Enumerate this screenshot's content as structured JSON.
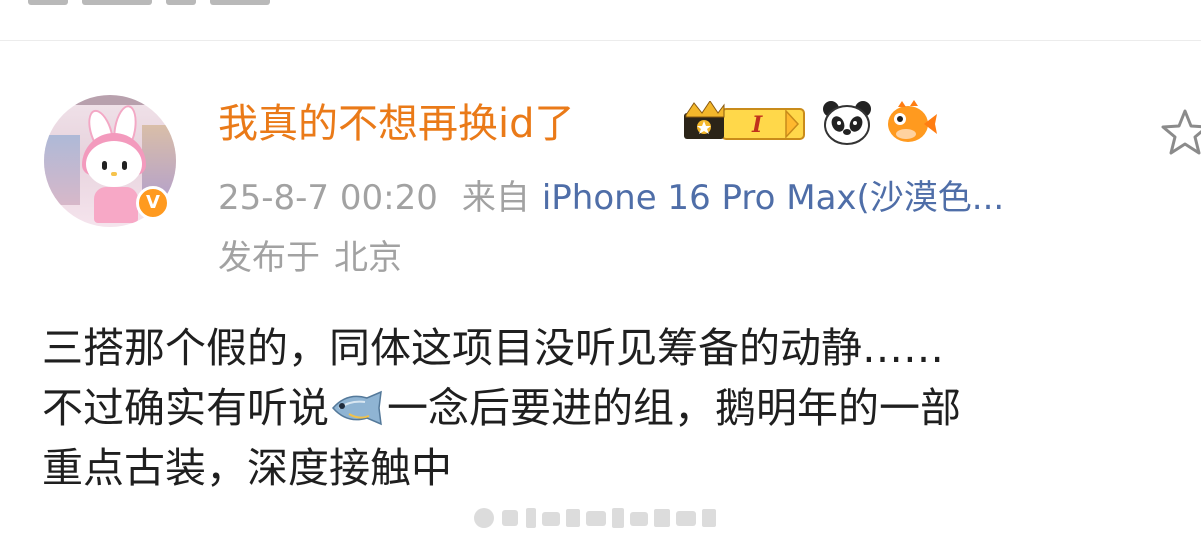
{
  "post": {
    "username": "我真的不想再换id了",
    "level_badge": "I",
    "time": "25-8-7 00:20",
    "from_label": "来自",
    "device": "iPhone 16 Pro Max(沙漠色...",
    "location_label": "发布于",
    "location_city": "北京",
    "body_lines": [
      {
        "text": "三搭那个假的，同体这项目没听见筹备的动静……"
      },
      {
        "before_emoji": "不过确实有听说",
        "after_emoji": "一念后要进的组，鹅明年的一部"
      },
      {
        "text": "重点古装，深度接触中"
      }
    ]
  },
  "icons": {
    "avatar": "avatar-image",
    "verified": "verified-v-icon",
    "level": "crown-level-badge-icon",
    "panda": "panda-emoji-icon",
    "puffer": "pufferfish-emoji-icon",
    "fish": "fish-emoji-icon",
    "star": "star-favorite-icon"
  },
  "colors": {
    "username": "#ea7a18",
    "meta": "#a2a2a2",
    "device": "#4f6ea8",
    "body_text": "#1f1f1f",
    "verified": "#ff9a1f"
  }
}
